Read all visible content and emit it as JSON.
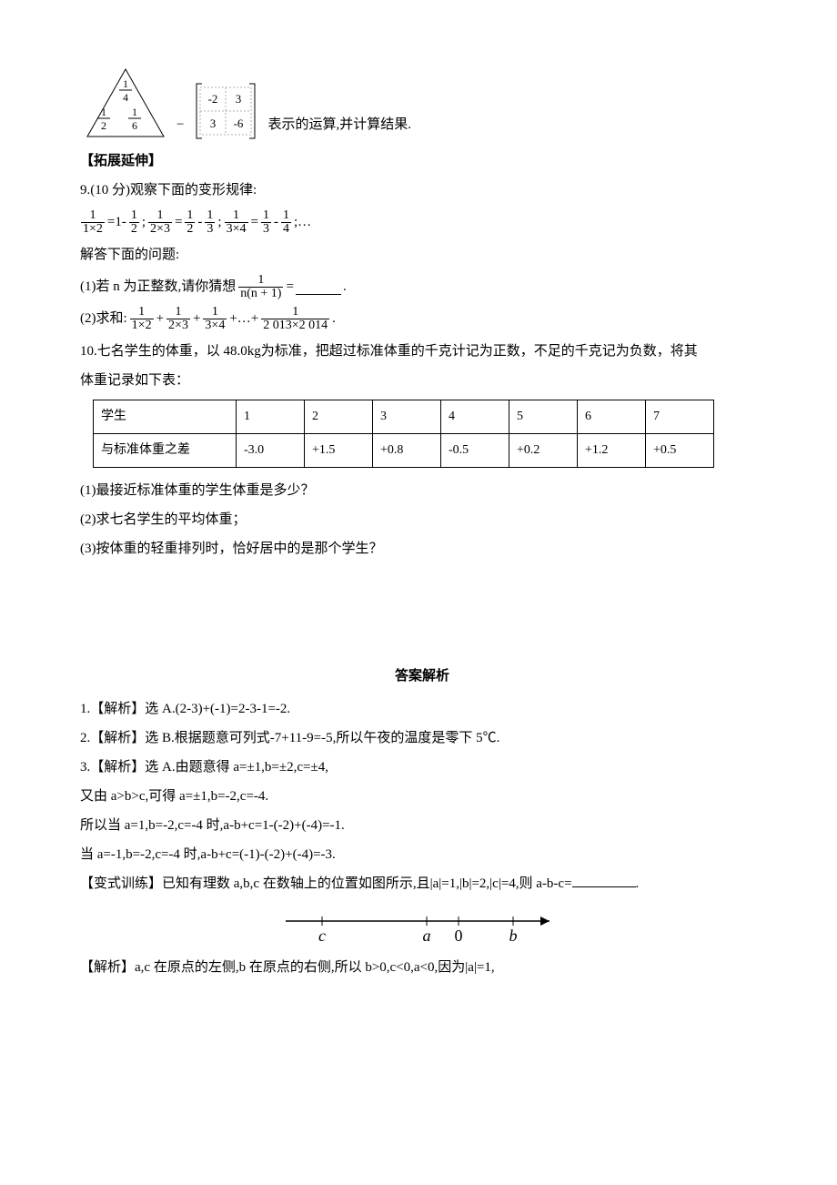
{
  "figures": {
    "triangle_caption_suffix": "表示的运算,并计算结果.",
    "triangle": {
      "top": {
        "num": "1",
        "den": "4"
      },
      "left": {
        "num": "1",
        "den": "2"
      },
      "right": {
        "num": "1",
        "den": "6"
      }
    },
    "bracket": {
      "r1c1": "-2",
      "r1c2": "3",
      "r2c1": "3",
      "r2c2": "-6"
    },
    "minus": "−"
  },
  "section_ext": "【拓展延伸】",
  "q9": {
    "stem": "9.(10 分)观察下面的变形规律:",
    "eqparts": {
      "t1": {
        "f1n": "1",
        "f1d": "1×2",
        "eq": "=1-",
        "f2n": "1",
        "f2d": "2",
        "sep": ";"
      },
      "t2": {
        "f1n": "1",
        "f1d": "2×3",
        "eq": "=",
        "f2n": "1",
        "f2d": "2",
        "minus": "-",
        "f3n": "1",
        "f3d": "3",
        "sep": ";"
      },
      "t3": {
        "f1n": "1",
        "f1d": "3×4",
        "eq": "=",
        "f2n": "1",
        "f2d": "3",
        "minus": "-",
        "f3n": "1",
        "f3d": "4",
        "sep": ";…"
      }
    },
    "sub_intro": "解答下面的问题:",
    "p1_a": "(1)若 n 为正整数,请你猜想",
    "p1_frac": {
      "num": "1",
      "den": "n(n + 1)"
    },
    "p1_b": "=",
    "p1_c": ".",
    "p2_a": "(2)求和:",
    "p2_terms": {
      "t1": {
        "num": "1",
        "den": "1×2"
      },
      "t2": {
        "num": "1",
        "den": "2×3"
      },
      "t3": {
        "num": "1",
        "den": "3×4"
      },
      "dots": "+…+",
      "t4": {
        "num": "1",
        "den": "2 013×2 014"
      },
      "end": "."
    }
  },
  "q10": {
    "stem1": "10.七名学生的体重，以 48.0kg为标准，把超过标准体重的千克计记为正数，不足的千克记为负数，将其",
    "stem2": "体重记录如下表：",
    "table": {
      "row1": {
        "label": "学生",
        "c1": "1",
        "c2": "2",
        "c3": "3",
        "c4": "4",
        "c5": "5",
        "c6": "6",
        "c7": "7"
      },
      "row2": {
        "label": "与标准体重之差",
        "c1": "-3.0",
        "c2": "+1.5",
        "c3": "+0.8",
        "c4": "-0.5",
        "c5": "+0.2",
        "c6": "+1.2",
        "c7": "+0.5"
      }
    },
    "p1": "(1)最接近标准体重的学生体重是多少？",
    "p2": "(2)求七名学生的平均体重；",
    "p3": "(3)按体重的轻重排列时，恰好居中的是那个学生？"
  },
  "answers_head": "答案解析",
  "a1": "1.【解析】选 A.(2-3)+(-1)=2-3-1=-2.",
  "a2": "2.【解析】选 B.根据题意可列式-7+11-9=-5,所以午夜的温度是零下 5℃.",
  "a3_l1": "3.【解析】选 A.由题意得 a=±1,b=±2,c=±4,",
  "a3_l2": "又由 a>b>c,可得 a=±1,b=-2,c=-4.",
  "a3_l3": "所以当 a=1,b=-2,c=-4 时,a-b+c=1-(-2)+(-4)=-1.",
  "a3_l4": "当 a=-1,b=-2,c=-4 时,a-b+c=(-1)-(-2)+(-4)=-3.",
  "variant_a": "【变式训练】已知有理数 a,b,c 在数轴上的位置如图所示,且|a|=1,|b|=2,|c|=4,则 a-b-c=",
  "variant_b": ".",
  "numberline": {
    "c": "c",
    "a": "a",
    "zero": "0",
    "b": "b"
  },
  "a_var": "【解析】a,c 在原点的左侧,b 在原点的右侧,所以 b>0,c<0,a<0,因为|a|=1,"
}
